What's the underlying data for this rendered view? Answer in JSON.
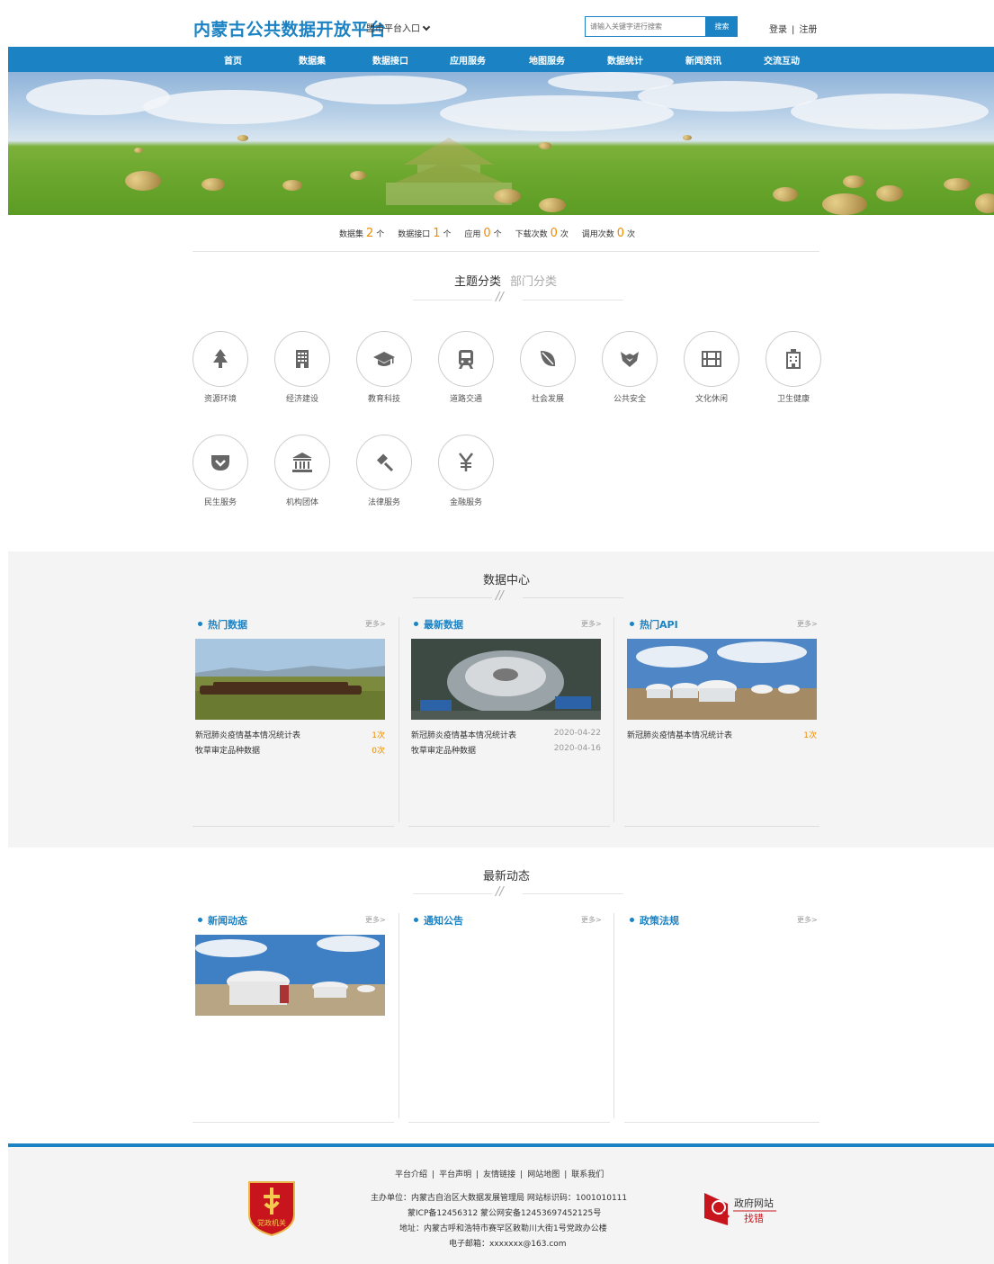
{
  "header": {
    "site_title": "内蒙古公共数据开放平台",
    "city_select": "盟市平台入口",
    "search_placeholder": "请输入关键字进行搜索",
    "search_button": "搜索",
    "login": "登录",
    "separator": "|",
    "register": "注册"
  },
  "nav": [
    "首页",
    "数据集",
    "数据接口",
    "应用服务",
    "地图服务",
    "数据统计",
    "新闻资讯",
    "交流互动"
  ],
  "stats": [
    {
      "label": "数据集",
      "value": "2",
      "unit": "个"
    },
    {
      "label": "数据接口",
      "value": "1",
      "unit": "个"
    },
    {
      "label": "应用",
      "value": "0",
      "unit": "个"
    },
    {
      "label": "下载次数",
      "value": "0",
      "unit": "次"
    },
    {
      "label": "调用次数",
      "value": "0",
      "unit": "次"
    }
  ],
  "category_tabs": {
    "active": "主题分类",
    "inactive": "部门分类",
    "divider": "//"
  },
  "categories": [
    {
      "label": "资源环境",
      "icon": "tree-icon"
    },
    {
      "label": "经济建设",
      "icon": "building-icon"
    },
    {
      "label": "教育科技",
      "icon": "graduation-cap-icon"
    },
    {
      "label": "道路交通",
      "icon": "train-icon"
    },
    {
      "label": "社会发展",
      "icon": "leaf-icon"
    },
    {
      "label": "公共安全",
      "icon": "shield-fox-icon"
    },
    {
      "label": "文化休闲",
      "icon": "film-icon"
    },
    {
      "label": "卫生健康",
      "icon": "hospital-icon"
    },
    {
      "label": "民生服务",
      "icon": "pocket-icon"
    },
    {
      "label": "机构团体",
      "icon": "institution-icon"
    },
    {
      "label": "法律服务",
      "icon": "gavel-icon"
    },
    {
      "label": "金融服务",
      "icon": "yen-icon"
    }
  ],
  "data_center": {
    "title": "数据中心",
    "divider": "//",
    "columns": [
      {
        "title": "热门数据",
        "more": "更多>",
        "photo": "horses-grassland-photo",
        "rows": [
          {
            "name": "新冠肺炎疫情基本情况统计表",
            "meta": "1次"
          },
          {
            "name": "牧草审定品种数据",
            "meta": "0次"
          }
        ]
      },
      {
        "title": "最新数据",
        "more": "更多>",
        "photo": "stadium-aerial-photo",
        "rows": [
          {
            "name": "新冠肺炎疫情基本情况统计表",
            "meta": "2020-04-22"
          },
          {
            "name": "牧草审定品种数据",
            "meta": "2020-04-16"
          }
        ]
      },
      {
        "title": "热门API",
        "more": "更多>",
        "photo": "yurts-photo",
        "rows": [
          {
            "name": "新冠肺炎疫情基本情况统计表",
            "meta": "1次"
          }
        ]
      }
    ]
  },
  "news": {
    "title": "最新动态",
    "divider": "//",
    "columns": [
      {
        "title": "新闻动态",
        "more": "更多>",
        "photo": "yurt-camp-photo"
      },
      {
        "title": "通知公告",
        "more": "更多>"
      },
      {
        "title": "政策法规",
        "more": "更多>"
      }
    ]
  },
  "footer": {
    "links": [
      "平台介绍",
      "平台声明",
      "友情链接",
      "网站地图",
      "联系我们"
    ],
    "separator": "|",
    "line1": "主办单位：内蒙古自治区大数据发展管理局    网站标识码：1001010111",
    "line2": "蒙ICP备12456312    蒙公网安备12453697452125号",
    "line3": "地址：内蒙古呼和浩特市赛罕区敕勒川大街1号党政办公楼",
    "line4": "电子邮箱：xxxxxxx@163.com",
    "badge_text": "党政机关",
    "gov_find_line1": "政府网站",
    "gov_find_line2": "找错"
  },
  "colors": {
    "brand_blue": "#1b83c4",
    "accent_orange": "#f08c00",
    "band_gray": "#f4f4f4"
  }
}
